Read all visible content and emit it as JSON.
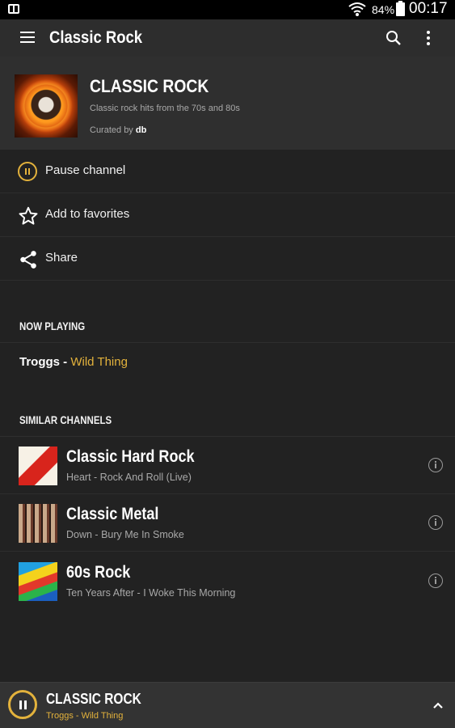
{
  "status_bar": {
    "battery": "84%",
    "time": "00:17"
  },
  "toolbar": {
    "title": "Classic Rock"
  },
  "channel": {
    "name": "CLASSIC ROCK",
    "description": "Classic rock hits from the 70s and 80s",
    "curated_prefix": "Curated by",
    "curator": "db"
  },
  "actions": [
    {
      "label": "Pause channel",
      "icon": "pause-circle-icon"
    },
    {
      "label": "Add to favorites",
      "icon": "star-outline-icon"
    },
    {
      "label": "Share",
      "icon": "share-icon"
    }
  ],
  "now_playing": {
    "header": "NOW PLAYING",
    "artist": "Troggs",
    "separator": " - ",
    "track": "Wild Thing"
  },
  "similar": {
    "header": "SIMILAR CHANNELS",
    "items": [
      {
        "name": "Classic Hard Rock",
        "subtitle": "Heart - Rock And Roll (Live)"
      },
      {
        "name": "Classic Metal",
        "subtitle": "Down - Bury Me In Smoke"
      },
      {
        "name": "60s Rock",
        "subtitle": "Ten Years After - I Woke This Morning"
      }
    ]
  },
  "mini_player": {
    "title": "CLASSIC ROCK",
    "subtitle": "Troggs - Wild Thing"
  },
  "colors": {
    "accent": "#e3b23c",
    "background": "#222222",
    "header": "#2f2f2f"
  }
}
